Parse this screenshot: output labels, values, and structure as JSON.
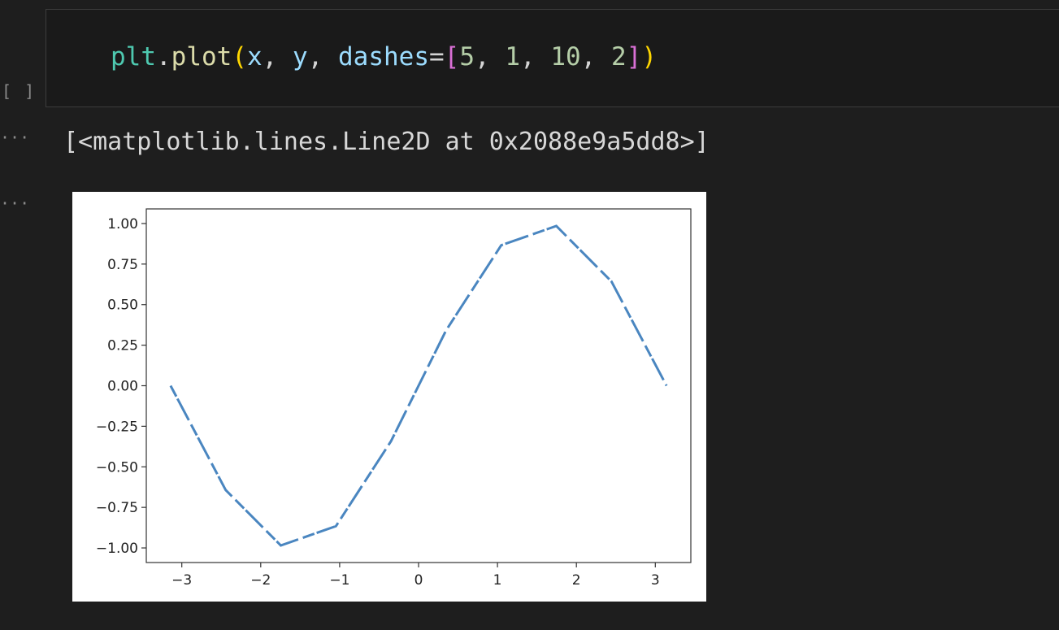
{
  "cell": {
    "execution_count": "[ ]",
    "code": {
      "module": "plt",
      "dot": ".",
      "func": "plot",
      "open_paren": "(",
      "arg_x": "x",
      "comma1": ", ",
      "arg_y": "y",
      "comma2": ", ",
      "kwarg": "dashes",
      "equals": "=",
      "open_bracket": "[",
      "n1": "5",
      "c1": ", ",
      "n2": "1",
      "c2": ", ",
      "n3": "10",
      "c3": ", ",
      "n4": "2",
      "close_bracket": "]",
      "close_paren": ")"
    }
  },
  "output": {
    "ellipsis_1": "···",
    "ellipsis_2": "···",
    "text": "[<matplotlib.lines.Line2D at 0x2088e9a5dd8>]"
  },
  "chart_data": {
    "type": "line",
    "line_style": "dashed",
    "dash_pattern": [
      5,
      1,
      10,
      2
    ],
    "line_color": "#4a86c0",
    "grid": false,
    "xlim": [
      -3.45,
      3.45
    ],
    "ylim": [
      -1.09,
      1.09
    ],
    "xticks": [
      -3,
      -2,
      -1,
      0,
      1,
      2,
      3
    ],
    "xtick_labels": [
      "−3",
      "−2",
      "−1",
      "0",
      "1",
      "2",
      "3"
    ],
    "yticks": [
      1.0,
      0.75,
      0.5,
      0.25,
      0.0,
      -0.25,
      -0.5,
      -0.75,
      -1.0
    ],
    "ytick_labels": [
      "1.00",
      "0.75",
      "0.50",
      "0.25",
      "0.00",
      "−0.25",
      "−0.50",
      "−0.75",
      "−1.00"
    ],
    "series": [
      {
        "x": [
          -3.1416,
          -2.4435,
          -1.7453,
          -1.0472,
          -0.3491,
          0.3491,
          1.0472,
          1.7453,
          2.4435,
          3.1416
        ],
        "y": [
          0.0,
          -0.643,
          -0.985,
          -0.866,
          -0.342,
          0.342,
          0.866,
          0.985,
          0.643,
          0.0
        ]
      }
    ]
  }
}
